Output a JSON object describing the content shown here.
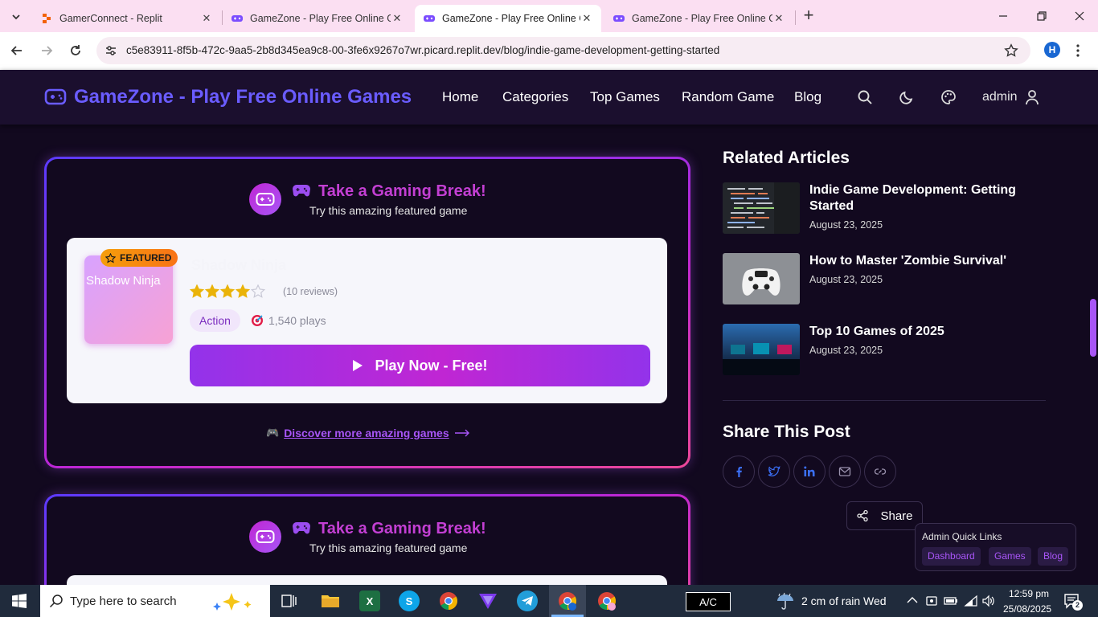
{
  "browser": {
    "tabs": [
      {
        "label": "GamerConnect - Replit"
      },
      {
        "label": "GameZone - Play Free Online G"
      },
      {
        "label": "GameZone - Play Free Online G"
      },
      {
        "label": "GameZone - Play Free Online G"
      }
    ],
    "url": "c5e83911-8f5b-472c-9aa5-2b8d345ea9c8-00-3fe6x9267o7wr.picard.replit.dev/blog/indie-game-development-getting-started",
    "profile_initial": "H",
    "close_glyph": "✕",
    "new_tab_glyph": "+"
  },
  "site": {
    "logo_text": "GameZone - Play Free Online Games",
    "nav": [
      "Home",
      "Categories",
      "Top Games",
      "Random Game",
      "Blog"
    ],
    "user": "admin"
  },
  "promos": [
    {
      "title": "Take a Gaming Break!",
      "subtitle": "Try this amazing featured game",
      "badge": "FEATURED",
      "image_alt": "Shadow Ninja",
      "game_title": "Shadow Ninja",
      "rating": 4,
      "rating_max": 5,
      "reviews": "(10 reviews)",
      "category": "Action",
      "plays": "1,540 plays",
      "play_button": "Play Now - Free!",
      "discover_link": "Discover more amazing games"
    },
    {
      "title": "Take a Gaming Break!",
      "subtitle": "Try this amazing featured game"
    }
  ],
  "sidebar": {
    "related_title": "Related Articles",
    "articles": [
      {
        "title": "Indie Game Development: Getting Started",
        "date": "August 23, 2025"
      },
      {
        "title": "How to Master 'Zombie Survival'",
        "date": "August 23, 2025"
      },
      {
        "title": "Top 10 Games of 2025",
        "date": "August 23, 2025"
      }
    ],
    "share_title": "Share This Post",
    "share_button": "Share",
    "share_icons": [
      "facebook-icon",
      "twitter-icon",
      "linkedin-icon",
      "mail-icon",
      "link-icon"
    ]
  },
  "admin_links": {
    "title": "Admin Quick Links",
    "links": [
      "Dashboard",
      "Games",
      "Blog"
    ]
  },
  "taskbar": {
    "search_placeholder": "Type here to search",
    "ac_label": "A/C",
    "weather": "2 cm of rain Wed",
    "time": "12:59 pm",
    "date": "25/08/2025",
    "notification_count": "2"
  },
  "colors": {
    "accent": "#6a5cff",
    "brand_pink": "#c33fd3",
    "play_gradient_start": "#9333ea",
    "play_gradient_end": "#c026d3",
    "star": "#eab308"
  }
}
